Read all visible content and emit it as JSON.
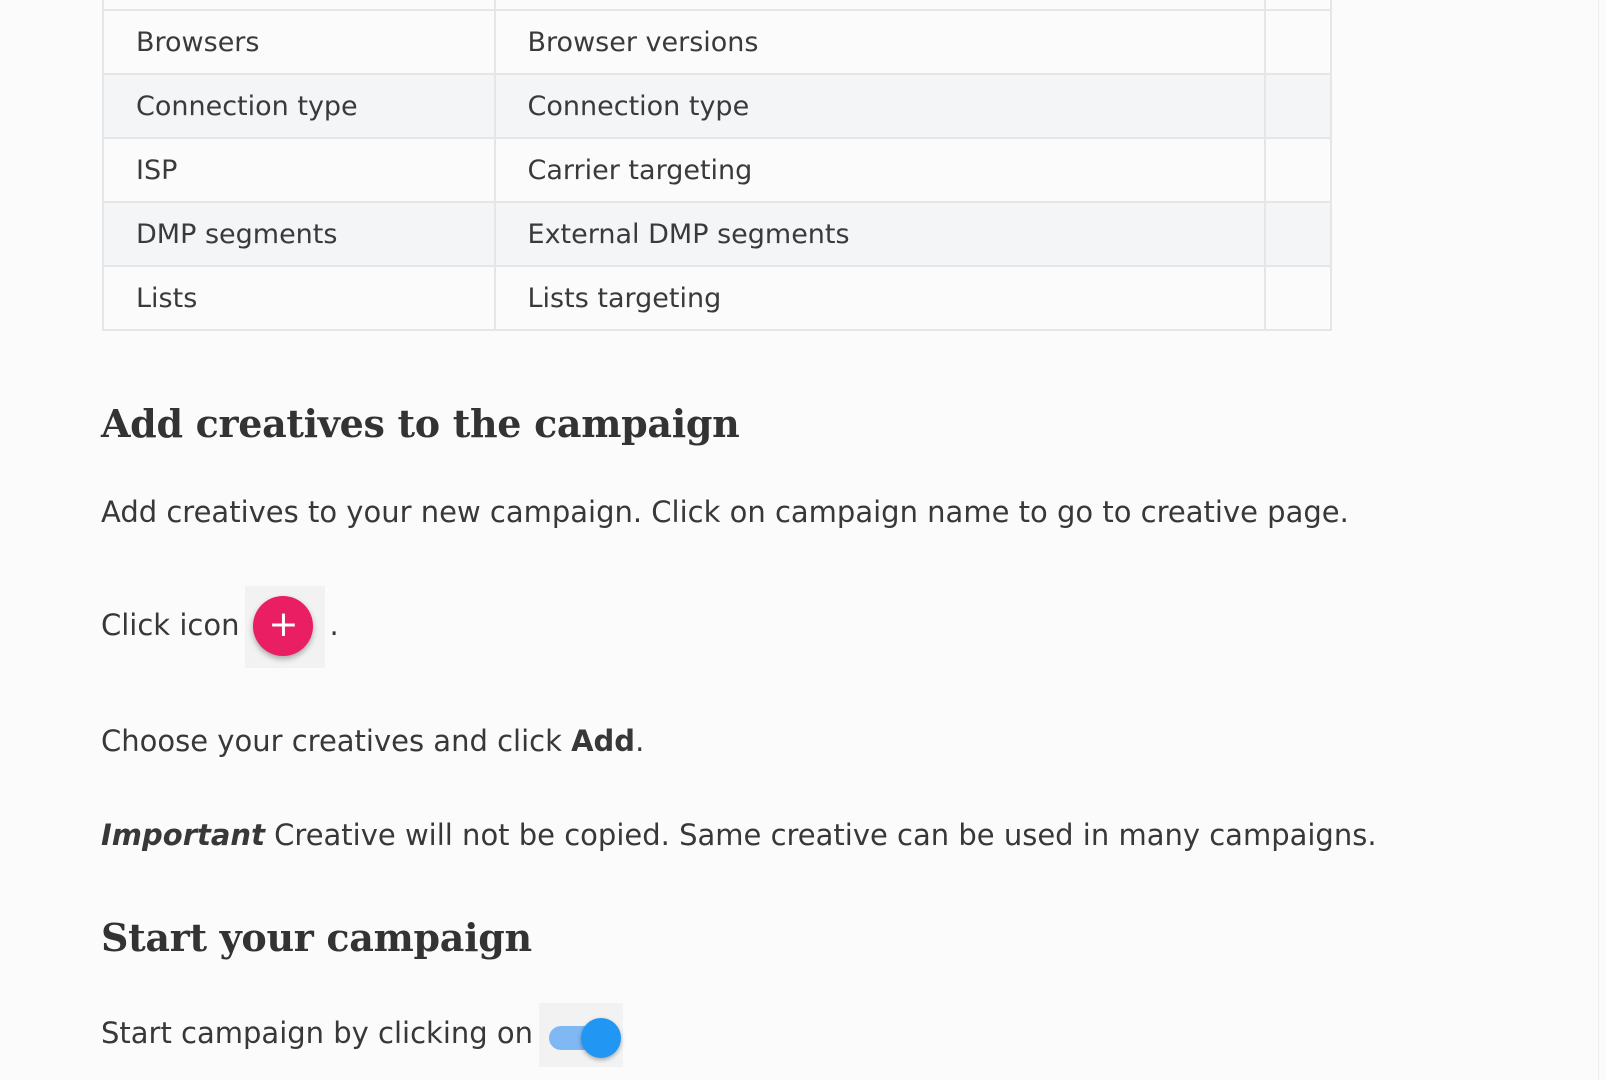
{
  "table": {
    "rows": [
      {
        "col1": "",
        "col2": "",
        "col3": ""
      },
      {
        "col1": "Browsers",
        "col2": "Browser versions",
        "col3": ""
      },
      {
        "col1": "Connection type",
        "col2": "Connection type",
        "col3": ""
      },
      {
        "col1": "ISP",
        "col2": "Carrier targeting",
        "col3": ""
      },
      {
        "col1": "DMP segments",
        "col2": "External DMP segments",
        "col3": ""
      },
      {
        "col1": "Lists",
        "col2": "Lists targeting",
        "col3": ""
      }
    ]
  },
  "section_add": {
    "heading": "Add creatives to the campaign",
    "intro": "Add creatives to your new campaign. Click on campaign name to go to creative page.",
    "click_icon_prefix": "Click icon",
    "click_icon_suffix": ".",
    "plus_symbol": "+",
    "choose_prefix": "Choose your creatives and click ",
    "choose_bold": "Add",
    "choose_suffix": ".",
    "important_label": "Important",
    "important_text": " Creative will not be copied. Same creative can be used in many campaigns."
  },
  "section_start": {
    "heading": "Start your campaign",
    "text": "Start campaign by clicking on"
  },
  "colors": {
    "accent_pink": "#e91e63",
    "toggle_blue": "#2196f3",
    "row_alt": "#f3f5f6"
  }
}
